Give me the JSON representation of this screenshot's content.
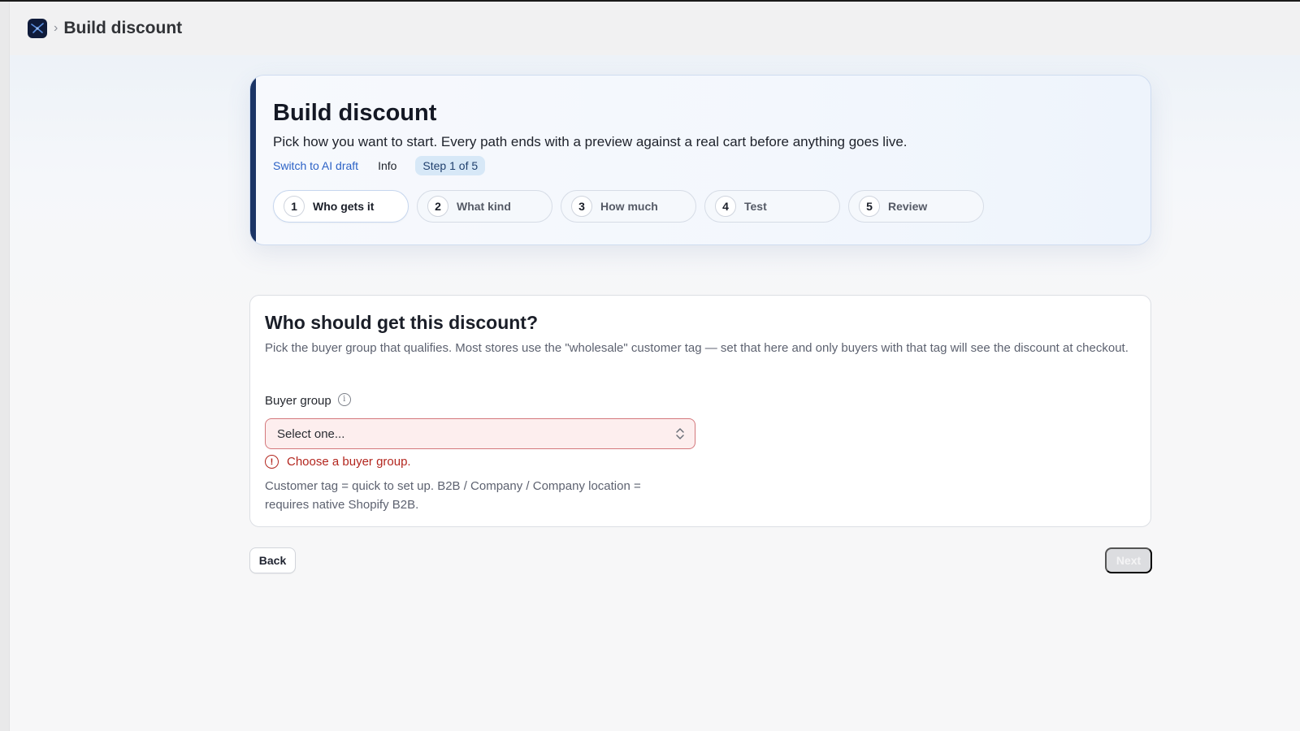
{
  "header": {
    "logo_icon": "app-logo-icon",
    "breadcrumb_separator": "›",
    "title": "Build discount"
  },
  "hero": {
    "title": "Build discount",
    "subtitle": "Pick how you want to start. Every path ends with a preview against a real cart before anything goes live.",
    "switch_link": "Switch to AI draft",
    "info_label": "Info",
    "step_indicator": "Step 1 of 5",
    "steps": [
      {
        "num": "1",
        "label": "Who gets it",
        "active": true
      },
      {
        "num": "2",
        "label": "What kind",
        "active": false
      },
      {
        "num": "3",
        "label": "How much",
        "active": false
      },
      {
        "num": "4",
        "label": "Test",
        "active": false
      },
      {
        "num": "5",
        "label": "Review",
        "active": false
      }
    ]
  },
  "card": {
    "title": "Who should get this discount?",
    "description": "Pick the buyer group that qualifies. Most stores use the \"wholesale\" customer tag — set that here and only buyers with that tag will see the discount at checkout.",
    "field_label": "Buyer group",
    "info_icon_glyph": "i",
    "select_value": "Select one...",
    "error_icon_glyph": "!",
    "error_text": "Choose a buyer group.",
    "help_text": "Customer tag = quick to set up. B2B / Company / Company location = requires native Shopify B2B."
  },
  "footer": {
    "back_label": "Back",
    "next_label": "Next",
    "next_disabled": true
  },
  "colors": {
    "accent_bar": "#1b3566",
    "link": "#2c62c6",
    "error": "#b3261e",
    "select_error_bg": "#fdeeee",
    "step_pill_bg": "#d7e8f7"
  }
}
